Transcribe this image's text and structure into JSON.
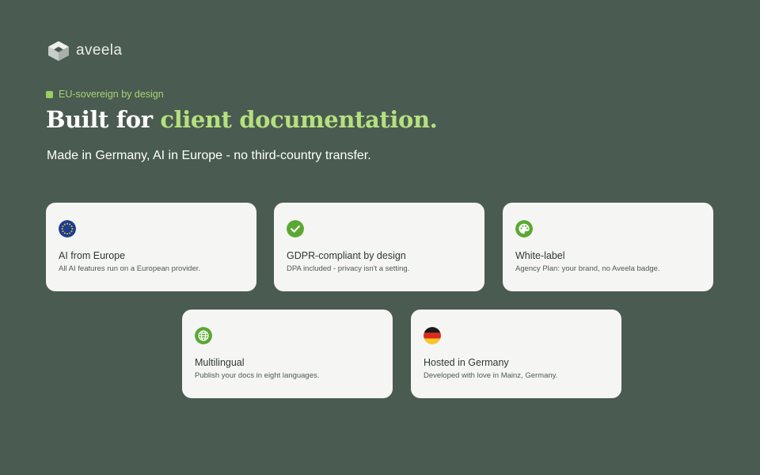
{
  "brand": {
    "name": "aveela",
    "accent_color": "#9bcf63",
    "background_color": "#4a5b51"
  },
  "eyebrow": "EU-sovereign by design",
  "headline": {
    "part1": "Built for ",
    "part2": "client documentation."
  },
  "subheadline": "Made in Germany, AI in Europe - no third-country transfer.",
  "features": [
    {
      "icon": "eu-flag-icon",
      "title": "AI from Europe",
      "description": "All AI features run on a European provider."
    },
    {
      "icon": "checkmark-icon",
      "title": "GDPR-compliant by design",
      "description": "DPA included - privacy isn't a setting."
    },
    {
      "icon": "palette-icon",
      "title": "White-label",
      "description": "Agency Plan: your brand, no Aveela badge."
    },
    {
      "icon": "globe-icon",
      "title": "Multilingual",
      "description": "Publish your docs in eight languages."
    },
    {
      "icon": "german-flag-icon",
      "title": "Hosted in Germany",
      "description": "Developed with love in Mainz, Germany."
    }
  ]
}
